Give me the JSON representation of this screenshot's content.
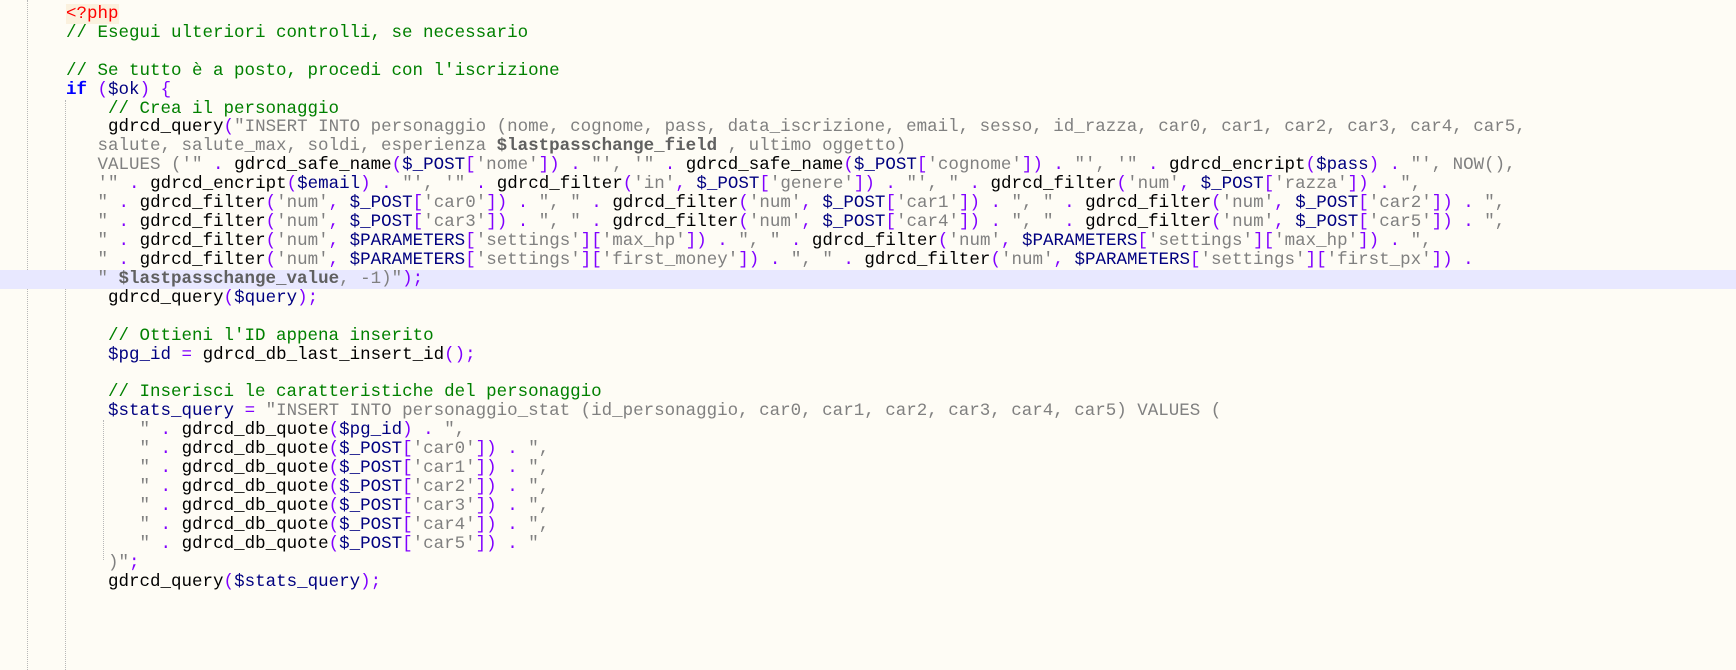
{
  "editor": {
    "language": "php",
    "current_line_index": 15,
    "colors": {
      "background": "#fefcf5",
      "current_line": "#e8e8ff",
      "comment": "#008000",
      "string": "#808080",
      "variable": "#000080",
      "operator": "#8000ff",
      "keyword": "#0000ff",
      "php_tag": "#ff0000"
    },
    "lines": [
      "",
      "<?php",
      "// Esegui ulteriori controlli, se necessario",
      "",
      "// Se tutto è a posto, procedi con l'iscrizione",
      "if ($ok) {",
      "    // Crea il personaggio",
      "    gdrcd_query(\"INSERT INTO personaggio (nome, cognome, pass, data_iscrizione, email, sesso, id_razza, car0, car1, car2, car3, car4, car5,",
      "   salute, salute_max, soldi, esperienza $lastpasschange_field , ultimo oggetto)",
      "   VALUES ('\" . gdrcd_safe_name($_POST['nome']) . \"', '\" . gdrcd_safe_name($_POST['cognome']) . \"', '\" . gdrcd_encript($pass) . \"', NOW(),",
      "   '\" . gdrcd_encript($email) . \"', '\" . gdrcd_filter('in', $_POST['genere']) . \"', \" . gdrcd_filter('num', $_POST['razza']) . \",",
      "   \" . gdrcd_filter('num', $_POST['car0']) . \", \" . gdrcd_filter('num', $_POST['car1']) . \", \" . gdrcd_filter('num', $_POST['car2']) . \",",
      "   \" . gdrcd_filter('num', $_POST['car3']) . \", \" . gdrcd_filter('num', $_POST['car4']) . \", \" . gdrcd_filter('num', $_POST['car5']) . \",",
      "   \" . gdrcd_filter('num', $PARAMETERS['settings']['max_hp']) . \", \" . gdrcd_filter('num', $PARAMETERS['settings']['max_hp']) . \",",
      "   \" . gdrcd_filter('num', $PARAMETERS['settings']['first_money']) . \", \" . gdrcd_filter('num', $PARAMETERS['settings']['first_px']) .",
      "   \" $lastpasschange_value, -1)\");",
      "    gdrcd_query($query);",
      "",
      "    // Ottieni l'ID appena inserito",
      "    $pg_id = gdrcd_db_last_insert_id();",
      "",
      "    // Inserisci le caratteristiche del personaggio",
      "    $stats_query = \"INSERT INTO personaggio_stat (id_personaggio, car0, car1, car2, car3, car4, car5) VALUES (",
      "       \" . gdrcd_db_quote($pg_id) . \",",
      "       \" . gdrcd_db_quote($_POST['car0']) . \",",
      "       \" . gdrcd_db_quote($_POST['car1']) . \",",
      "       \" . gdrcd_db_quote($_POST['car2']) . \",",
      "       \" . gdrcd_db_quote($_POST['car3']) . \",",
      "       \" . gdrcd_db_quote($_POST['car4']) . \",",
      "       \" . gdrcd_db_quote($_POST['car5']) . \"",
      "    )\";",
      "    gdrcd_query($stats_query);"
    ]
  }
}
